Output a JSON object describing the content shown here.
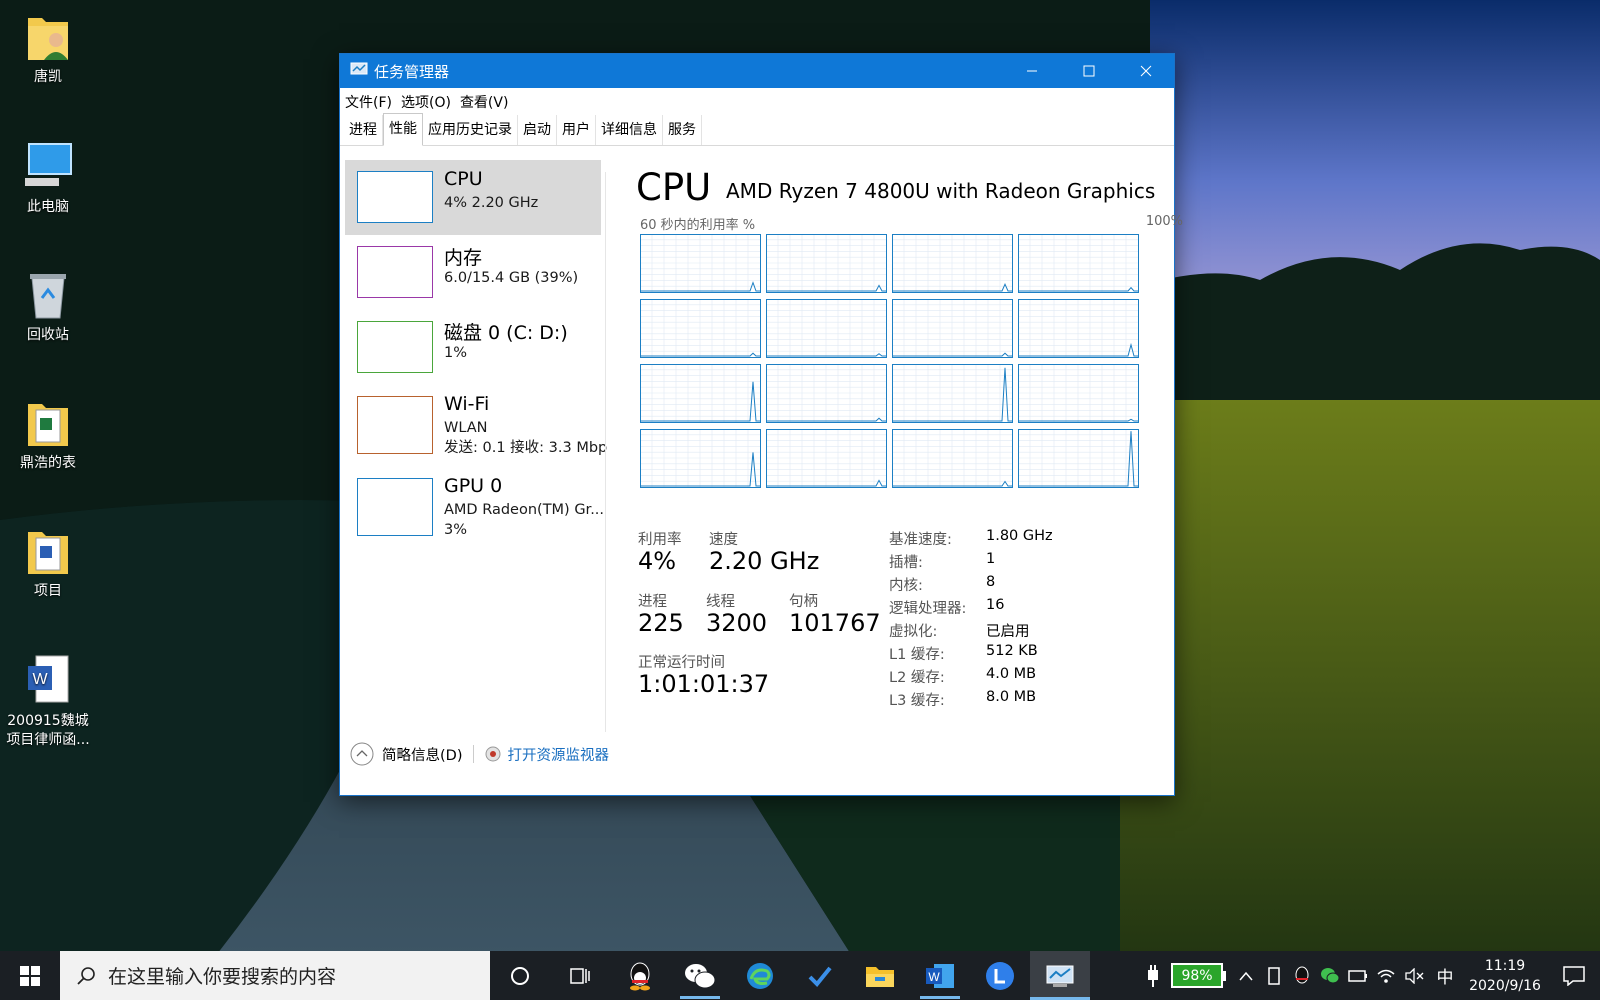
{
  "desktop": {
    "icons": [
      {
        "label": "唐凯",
        "icon": "user-folder-icon"
      },
      {
        "label": "此电脑",
        "icon": "computer-icon"
      },
      {
        "label": "回收站",
        "icon": "recycle-bin-icon"
      },
      {
        "label": "鼎浩的表",
        "icon": "excel-folder-icon"
      },
      {
        "label": "项目",
        "icon": "word-folder-icon"
      },
      {
        "label_line1": "200915魏城",
        "label_line2": "项目律师函...",
        "icon": "word-document-icon"
      }
    ]
  },
  "window": {
    "title": "任务管理器",
    "controls": {
      "minimize": "minimize-icon",
      "maximize": "maximize-icon",
      "close": "close-icon"
    },
    "menu": [
      "文件(F)",
      "选项(O)",
      "查看(V)"
    ],
    "tabs": [
      "进程",
      "性能",
      "应用历史记录",
      "启动",
      "用户",
      "详细信息",
      "服务"
    ],
    "active_tab": "性能",
    "sidebar": [
      {
        "name": "CPU",
        "sub1": "4%  2.20 GHz",
        "color": "#1c7fc4",
        "selected": true
      },
      {
        "name": "内存",
        "sub1": "6.0/15.4 GB (39%)",
        "color": "#9a38a8"
      },
      {
        "name": "磁盘 0 (C: D:)",
        "sub1": "1%",
        "color": "#4aa63b"
      },
      {
        "name": "Wi-Fi",
        "sub1": "WLAN",
        "sub2": "发送: 0.1  接收: 3.3 Mbp",
        "color": "#b8622e"
      },
      {
        "name": "GPU 0",
        "sub1": "AMD Radeon(TM) Gr...",
        "sub2": "3%",
        "color": "#1c7fc4"
      }
    ],
    "cpu": {
      "title": "CPU",
      "model": "AMD Ryzen 7 4800U with Radeon Graphics",
      "graph_caption": "60 秒内的利用率 %",
      "graph_max": "100%",
      "graph_color": "#1c7fc4",
      "logical_graphs": 16,
      "stats": {
        "utilization_label": "利用率",
        "utilization": "4%",
        "speed_label": "速度",
        "speed": "2.20 GHz",
        "processes_label": "进程",
        "processes": "225",
        "threads_label": "线程",
        "threads": "3200",
        "handles_label": "句柄",
        "handles": "101767",
        "uptime_label": "正常运行时间",
        "uptime": "1:01:01:37"
      },
      "specs": [
        {
          "label": "基准速度:",
          "value": "1.80 GHz"
        },
        {
          "label": "插槽:",
          "value": "1"
        },
        {
          "label": "内核:",
          "value": "8"
        },
        {
          "label": "逻辑处理器:",
          "value": "16"
        },
        {
          "label": "虚拟化:",
          "value": "已启用"
        },
        {
          "label": "L1 缓存:",
          "value": "512 KB"
        },
        {
          "label": "L2 缓存:",
          "value": "4.0 MB"
        },
        {
          "label": "L3 缓存:",
          "value": "8.0 MB"
        }
      ]
    },
    "footer": {
      "fewer_details": "简略信息(D)",
      "open_resmon": "打开资源监视器"
    }
  },
  "taskbar": {
    "search_placeholder": "在这里输入你要搜索的内容",
    "apps": [
      "cortana-icon",
      "task-view-icon",
      "qq-icon",
      "wechat-icon",
      "edge-icon",
      "todo-icon",
      "file-explorer-icon",
      "word-icon",
      "lark-icon",
      "task-manager-icon"
    ],
    "battery": "98%",
    "ime": "中",
    "time": "11:19",
    "date": "2020/9/16"
  }
}
